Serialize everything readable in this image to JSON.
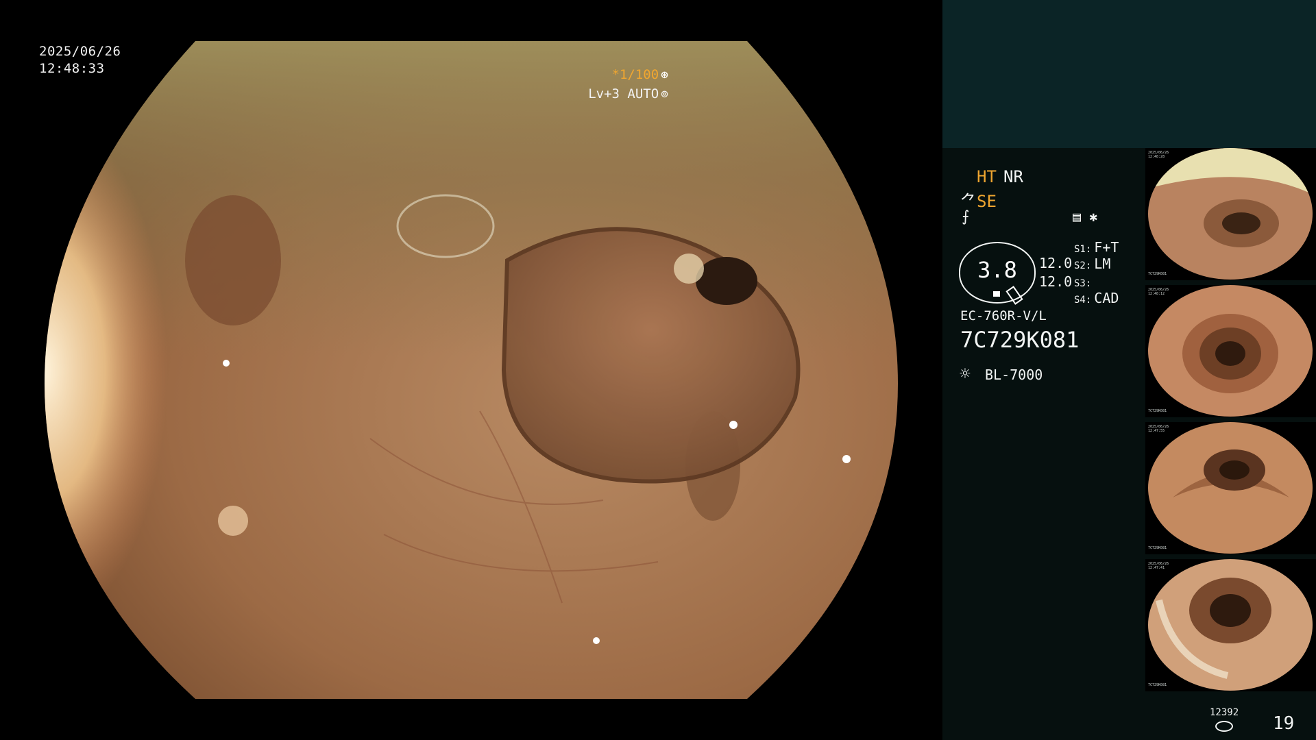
{
  "overlay": {
    "date": "2025/06/26",
    "time": "12:48:33",
    "shutter": "*1/100",
    "shutter_icon": "aperture-icon",
    "level": "Lv+3 AUTO",
    "level_icon": "iris-icon"
  },
  "panel": {
    "ht": "HT",
    "nr": "NR",
    "se_icon": "⺈",
    "se": "SE",
    "enhance_icon": "⨍",
    "mode_icons": "▤ ✱",
    "gauge_value": "3.8",
    "gain1": "12.0",
    "gain2": "12.0",
    "switches": [
      {
        "label": "S1:",
        "value": "F+T"
      },
      {
        "label": "S2:",
        "value": "LM"
      },
      {
        "label": "S3:",
        "value": ""
      },
      {
        "label": "S4:",
        "value": "CAD"
      }
    ],
    "scope_model": "EC-760R-V/L",
    "scope_serial": "7C729K081",
    "light_icon": "☼",
    "light_source": "BL-7000",
    "storage_count": "12392",
    "image_count": "19"
  },
  "thumbnails": [
    {
      "date": "2025/06/26",
      "time": "12:48:28",
      "serial": "7C729K081"
    },
    {
      "date": "2025/06/26",
      "time": "12:48:12",
      "serial": "7C729K081"
    },
    {
      "date": "2025/06/26",
      "time": "12:47:55",
      "serial": "7C729K081"
    },
    {
      "date": "2025/06/26",
      "time": "12:47:41",
      "serial": "7C729K081"
    }
  ],
  "colors": {
    "accent": "#f0a630",
    "panel_bg": "#06100f",
    "panel_top": "#0b2426",
    "mucosa": "#b07a55"
  }
}
